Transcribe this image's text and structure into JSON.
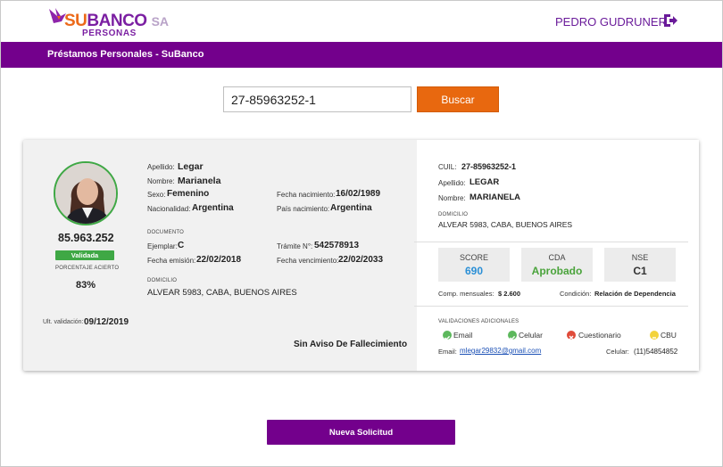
{
  "header": {
    "brand_main": "SUBANCO",
    "brand_su": "SU",
    "brand_banco": "BANCO",
    "brand_sa": "SA",
    "brand_sub": "PERSONAS",
    "user_name": "PEDRO GUDRUNER",
    "logout_icon": "logout-icon"
  },
  "nav": {
    "title": "Préstamos Personales - SuBanco"
  },
  "search": {
    "value": "27-85963252-1",
    "button_label": "Buscar"
  },
  "person": {
    "dni": "85.963.252",
    "status_badge": "Validada",
    "percentage_label": "PORCENTAJE ACIERTO",
    "percentage_value": "83%",
    "validation_label": "Ult. validación:",
    "validation_date": "09/12/2019",
    "apellido_label": "Apellido:",
    "apellido": "Legar",
    "nombre_label": "Nombre:",
    "nombre": "Marianela",
    "sexo_label": "Sexo:",
    "sexo": "Femenino",
    "nacionalidad_label": "Nacionalidad:",
    "nacionalidad": "Argentina",
    "fecha_nac_label": "Fecha nacimiento:",
    "fecha_nac": "16/02/1989",
    "pais_nac_label": "País nacimiento:",
    "pais_nac": "Argentina",
    "documento_label": "DOCUMENTO",
    "ejemplar_label": "Ejemplar:",
    "ejemplar": "C",
    "fecha_emision_label": "Fecha emisión:",
    "fecha_emision": "22/02/2018",
    "tramite_label": "Trámite N°:",
    "tramite": "542578913",
    "fecha_venc_label": "Fecha vencimiento:",
    "fecha_venc": "22/02/2033",
    "domicilio_label": "DOMICILIO",
    "domicilio": "ALVEAR 5983, CABA, BUENOS AIRES",
    "fallecimiento": "Sin Aviso De Fallecimiento"
  },
  "summary": {
    "cuil_label": "CUIL:",
    "cuil": "27-85963252-1",
    "apellido_label": "Apellido:",
    "apellido": "LEGAR",
    "nombre_label": "Nombre:",
    "nombre": "MARIANELA",
    "domicilio_label": "DOMICILIO",
    "domicilio": "ALVEAR 5983, CABA, BUENOS AIRES",
    "score_label": "SCORE",
    "score_value": "690",
    "cda_label": "CDA",
    "cda_value": "Aprobado",
    "nse_label": "NSE",
    "nse_value": "C1",
    "comp_label": "Comp. mensuales:",
    "comp_value": "$ 2.600",
    "condicion_label": "Condición:",
    "condicion_value": "Relación de Dependencia",
    "validaciones_label": "VALIDACIONES ADICIONALES",
    "validaciones": [
      {
        "label": "Email",
        "state": "ok",
        "color": "#5cb85c"
      },
      {
        "label": "Celular",
        "state": "ok",
        "color": "#5cb85c"
      },
      {
        "label": "Cuestionario",
        "state": "fail",
        "color": "#e04b3a"
      },
      {
        "label": "CBU",
        "state": "pending",
        "color": "#f3d33a"
      }
    ],
    "email_label": "Email:",
    "email": "mlegar29832@gmail.com",
    "celular_label": "Celular:",
    "celular": "(11)54854852"
  },
  "actions": {
    "new_request_label": "Nueva Solicitud"
  },
  "colors": {
    "brand_purple": "#73008c",
    "brand_orange": "#e8680f",
    "success_green": "#3fa845",
    "score_blue": "#2a8fd6",
    "approved_green": "#4aa33b"
  }
}
